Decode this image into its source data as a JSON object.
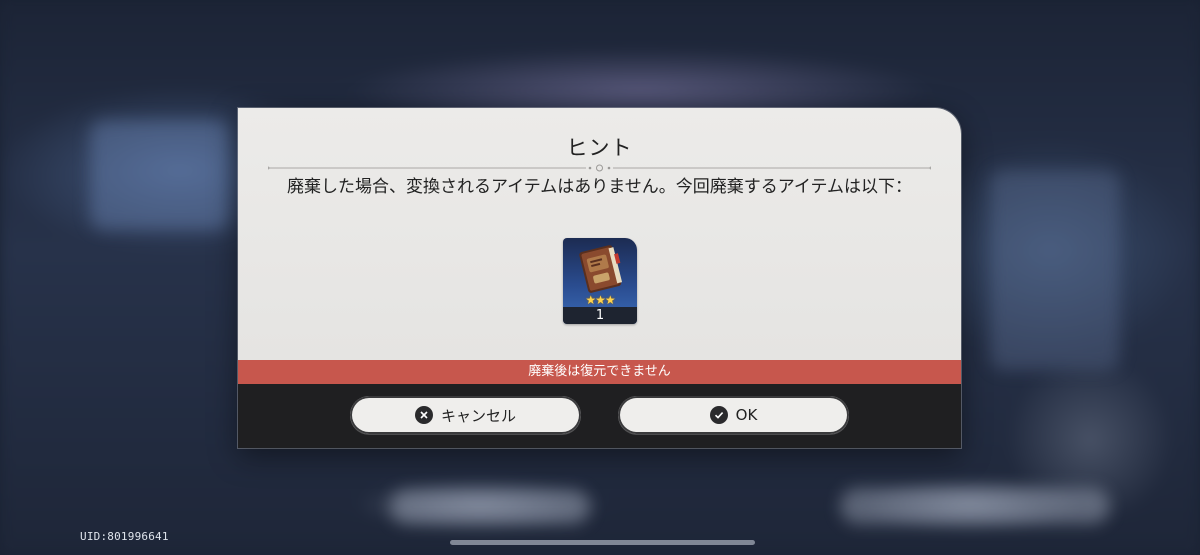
{
  "dialog": {
    "title": "ヒント",
    "message": "廃棄した場合、変換されるアイテムはありません。今回廃棄するアイテムは以下：",
    "item": {
      "name": "book-icon",
      "stars": "★★★",
      "count": "1"
    },
    "warning": "廃棄後は復元できません",
    "cancel_label": "キャンセル",
    "ok_label": "OK"
  },
  "footer": {
    "uid": "UID:801996641"
  },
  "colors": {
    "warning_bar": "#c7574d",
    "button_bar": "#1f1f21",
    "dialog_bg": "#ecebe9",
    "item_card": "#2a4c8f"
  }
}
